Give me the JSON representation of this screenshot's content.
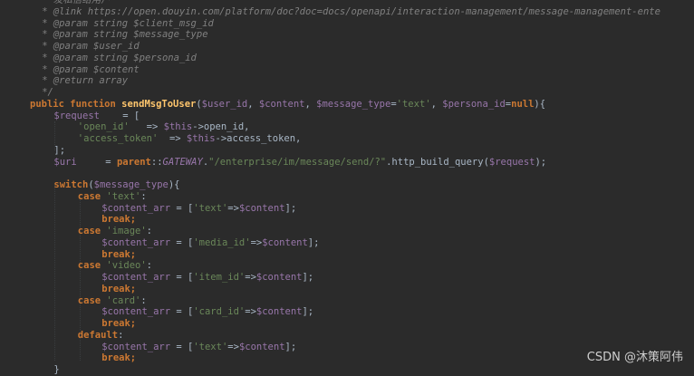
{
  "colors": {
    "background": "#2b2b2b",
    "comment": "#808080",
    "keyword": "#cc7832",
    "function_name": "#ffc66d",
    "variable": "#9876aa",
    "string": "#6a8759",
    "plain": "#a9b7c6",
    "constant": "#9876aa"
  },
  "editor": {
    "lines": [
      {
        "indent": 2,
        "tokens": [
          {
            "t": "* 发私信给用户",
            "c": "comment"
          }
        ]
      },
      {
        "indent": 2,
        "tokens": [
          {
            "t": "* @link https://open.douyin.com/platform/doc?doc=docs/openapi/interaction-management/message-management-ente",
            "c": "comment"
          }
        ]
      },
      {
        "indent": 2,
        "tokens": [
          {
            "t": "* @param string $client_msg_id",
            "c": "comment"
          }
        ]
      },
      {
        "indent": 2,
        "tokens": [
          {
            "t": "* @param string $message_type",
            "c": "comment"
          }
        ]
      },
      {
        "indent": 2,
        "tokens": [
          {
            "t": "* @param $user_id",
            "c": "comment"
          }
        ]
      },
      {
        "indent": 2,
        "tokens": [
          {
            "t": "* @param string $persona_id",
            "c": "comment"
          }
        ]
      },
      {
        "indent": 2,
        "tokens": [
          {
            "t": "* @param $content",
            "c": "comment"
          }
        ]
      },
      {
        "indent": 2,
        "tokens": [
          {
            "t": "* @return array",
            "c": "comment"
          }
        ]
      },
      {
        "indent": 2,
        "tokens": [
          {
            "t": "*/",
            "c": "comment"
          }
        ]
      },
      {
        "indent": 0,
        "tokens": [
          {
            "t": "public function ",
            "c": "keyword"
          },
          {
            "t": "sendMsgToUser",
            "c": "function_name"
          },
          {
            "t": "(",
            "c": "plain"
          },
          {
            "t": "$user_id",
            "c": "variable"
          },
          {
            "t": ", ",
            "c": "plain"
          },
          {
            "t": "$content",
            "c": "variable"
          },
          {
            "t": ", ",
            "c": "plain"
          },
          {
            "t": "$message_type",
            "c": "variable"
          },
          {
            "t": "=",
            "c": "plain"
          },
          {
            "t": "'text'",
            "c": "string"
          },
          {
            "t": ", ",
            "c": "plain"
          },
          {
            "t": "$persona_id",
            "c": "variable"
          },
          {
            "t": "=",
            "c": "plain"
          },
          {
            "t": "null",
            "c": "keyword"
          },
          {
            "t": "){",
            "c": "plain"
          }
        ]
      },
      {
        "indent": 4,
        "tokens": [
          {
            "t": "$request",
            "c": "variable"
          },
          {
            "t": "    = [",
            "c": "plain"
          }
        ]
      },
      {
        "indent": 8,
        "tokens": [
          {
            "t": "'open_id'",
            "c": "string"
          },
          {
            "t": "   => ",
            "c": "plain"
          },
          {
            "t": "$this",
            "c": "variable"
          },
          {
            "t": "->open_id,",
            "c": "plain"
          }
        ]
      },
      {
        "indent": 8,
        "tokens": [
          {
            "t": "'access_token'",
            "c": "string"
          },
          {
            "t": "  => ",
            "c": "plain"
          },
          {
            "t": "$this",
            "c": "variable"
          },
          {
            "t": "->access_token,",
            "c": "plain"
          }
        ]
      },
      {
        "indent": 4,
        "tokens": [
          {
            "t": "];",
            "c": "plain"
          }
        ]
      },
      {
        "indent": 4,
        "tokens": [
          {
            "t": "$uri",
            "c": "variable"
          },
          {
            "t": "     = ",
            "c": "plain"
          },
          {
            "t": "parent",
            "c": "keyword"
          },
          {
            "t": "::",
            "c": "plain"
          },
          {
            "t": "GATEWAY",
            "c": "constant"
          },
          {
            "t": ".",
            "c": "plain"
          },
          {
            "t": "\"/enterprise/im/message/send/?\"",
            "c": "string"
          },
          {
            "t": ".http_build_query(",
            "c": "plain"
          },
          {
            "t": "$request",
            "c": "variable"
          },
          {
            "t": ");",
            "c": "plain"
          }
        ]
      },
      {
        "indent": 0,
        "tokens": []
      },
      {
        "indent": 4,
        "tokens": [
          {
            "t": "switch",
            "c": "keyword"
          },
          {
            "t": "(",
            "c": "plain"
          },
          {
            "t": "$message_type",
            "c": "variable"
          },
          {
            "t": "){",
            "c": "plain"
          }
        ]
      },
      {
        "indent": 8,
        "tokens": [
          {
            "t": "case ",
            "c": "keyword"
          },
          {
            "t": "'text'",
            "c": "string"
          },
          {
            "t": ":",
            "c": "plain"
          }
        ]
      },
      {
        "indent": 12,
        "tokens": [
          {
            "t": "$content_arr",
            "c": "variable"
          },
          {
            "t": " = [",
            "c": "plain"
          },
          {
            "t": "'text'",
            "c": "string"
          },
          {
            "t": "=>",
            "c": "plain"
          },
          {
            "t": "$content",
            "c": "variable"
          },
          {
            "t": "];",
            "c": "plain"
          }
        ]
      },
      {
        "indent": 12,
        "tokens": [
          {
            "t": "break;",
            "c": "keyword"
          }
        ]
      },
      {
        "indent": 8,
        "tokens": [
          {
            "t": "case ",
            "c": "keyword"
          },
          {
            "t": "'image'",
            "c": "string"
          },
          {
            "t": ":",
            "c": "plain"
          }
        ]
      },
      {
        "indent": 12,
        "tokens": [
          {
            "t": "$content_arr",
            "c": "variable"
          },
          {
            "t": " = [",
            "c": "plain"
          },
          {
            "t": "'media_id'",
            "c": "string"
          },
          {
            "t": "=>",
            "c": "plain"
          },
          {
            "t": "$content",
            "c": "variable"
          },
          {
            "t": "];",
            "c": "plain"
          }
        ]
      },
      {
        "indent": 12,
        "tokens": [
          {
            "t": "break;",
            "c": "keyword"
          }
        ]
      },
      {
        "indent": 8,
        "tokens": [
          {
            "t": "case ",
            "c": "keyword"
          },
          {
            "t": "'video'",
            "c": "string"
          },
          {
            "t": ":",
            "c": "plain"
          }
        ]
      },
      {
        "indent": 12,
        "tokens": [
          {
            "t": "$content_arr",
            "c": "variable"
          },
          {
            "t": " = [",
            "c": "plain"
          },
          {
            "t": "'item_id'",
            "c": "string"
          },
          {
            "t": "=>",
            "c": "plain"
          },
          {
            "t": "$content",
            "c": "variable"
          },
          {
            "t": "];",
            "c": "plain"
          }
        ]
      },
      {
        "indent": 12,
        "tokens": [
          {
            "t": "break;",
            "c": "keyword"
          }
        ]
      },
      {
        "indent": 8,
        "tokens": [
          {
            "t": "case ",
            "c": "keyword"
          },
          {
            "t": "'card'",
            "c": "string"
          },
          {
            "t": ":",
            "c": "plain"
          }
        ]
      },
      {
        "indent": 12,
        "tokens": [
          {
            "t": "$content_arr",
            "c": "variable"
          },
          {
            "t": " = [",
            "c": "plain"
          },
          {
            "t": "'card_id'",
            "c": "string"
          },
          {
            "t": "=>",
            "c": "plain"
          },
          {
            "t": "$content",
            "c": "variable"
          },
          {
            "t": "];",
            "c": "plain"
          }
        ]
      },
      {
        "indent": 12,
        "tokens": [
          {
            "t": "break;",
            "c": "keyword"
          }
        ]
      },
      {
        "indent": 8,
        "tokens": [
          {
            "t": "default",
            "c": "keyword"
          },
          {
            "t": ":",
            "c": "plain"
          }
        ]
      },
      {
        "indent": 12,
        "tokens": [
          {
            "t": "$content_arr",
            "c": "variable"
          },
          {
            "t": " = [",
            "c": "plain"
          },
          {
            "t": "'text'",
            "c": "string"
          },
          {
            "t": "=>",
            "c": "plain"
          },
          {
            "t": "$content",
            "c": "variable"
          },
          {
            "t": "];",
            "c": "plain"
          }
        ]
      },
      {
        "indent": 12,
        "tokens": [
          {
            "t": "break;",
            "c": "keyword"
          }
        ]
      },
      {
        "indent": 4,
        "tokens": [
          {
            "t": "}",
            "c": "plain"
          }
        ]
      }
    ]
  },
  "watermark": "CSDN @沐策阿伟"
}
